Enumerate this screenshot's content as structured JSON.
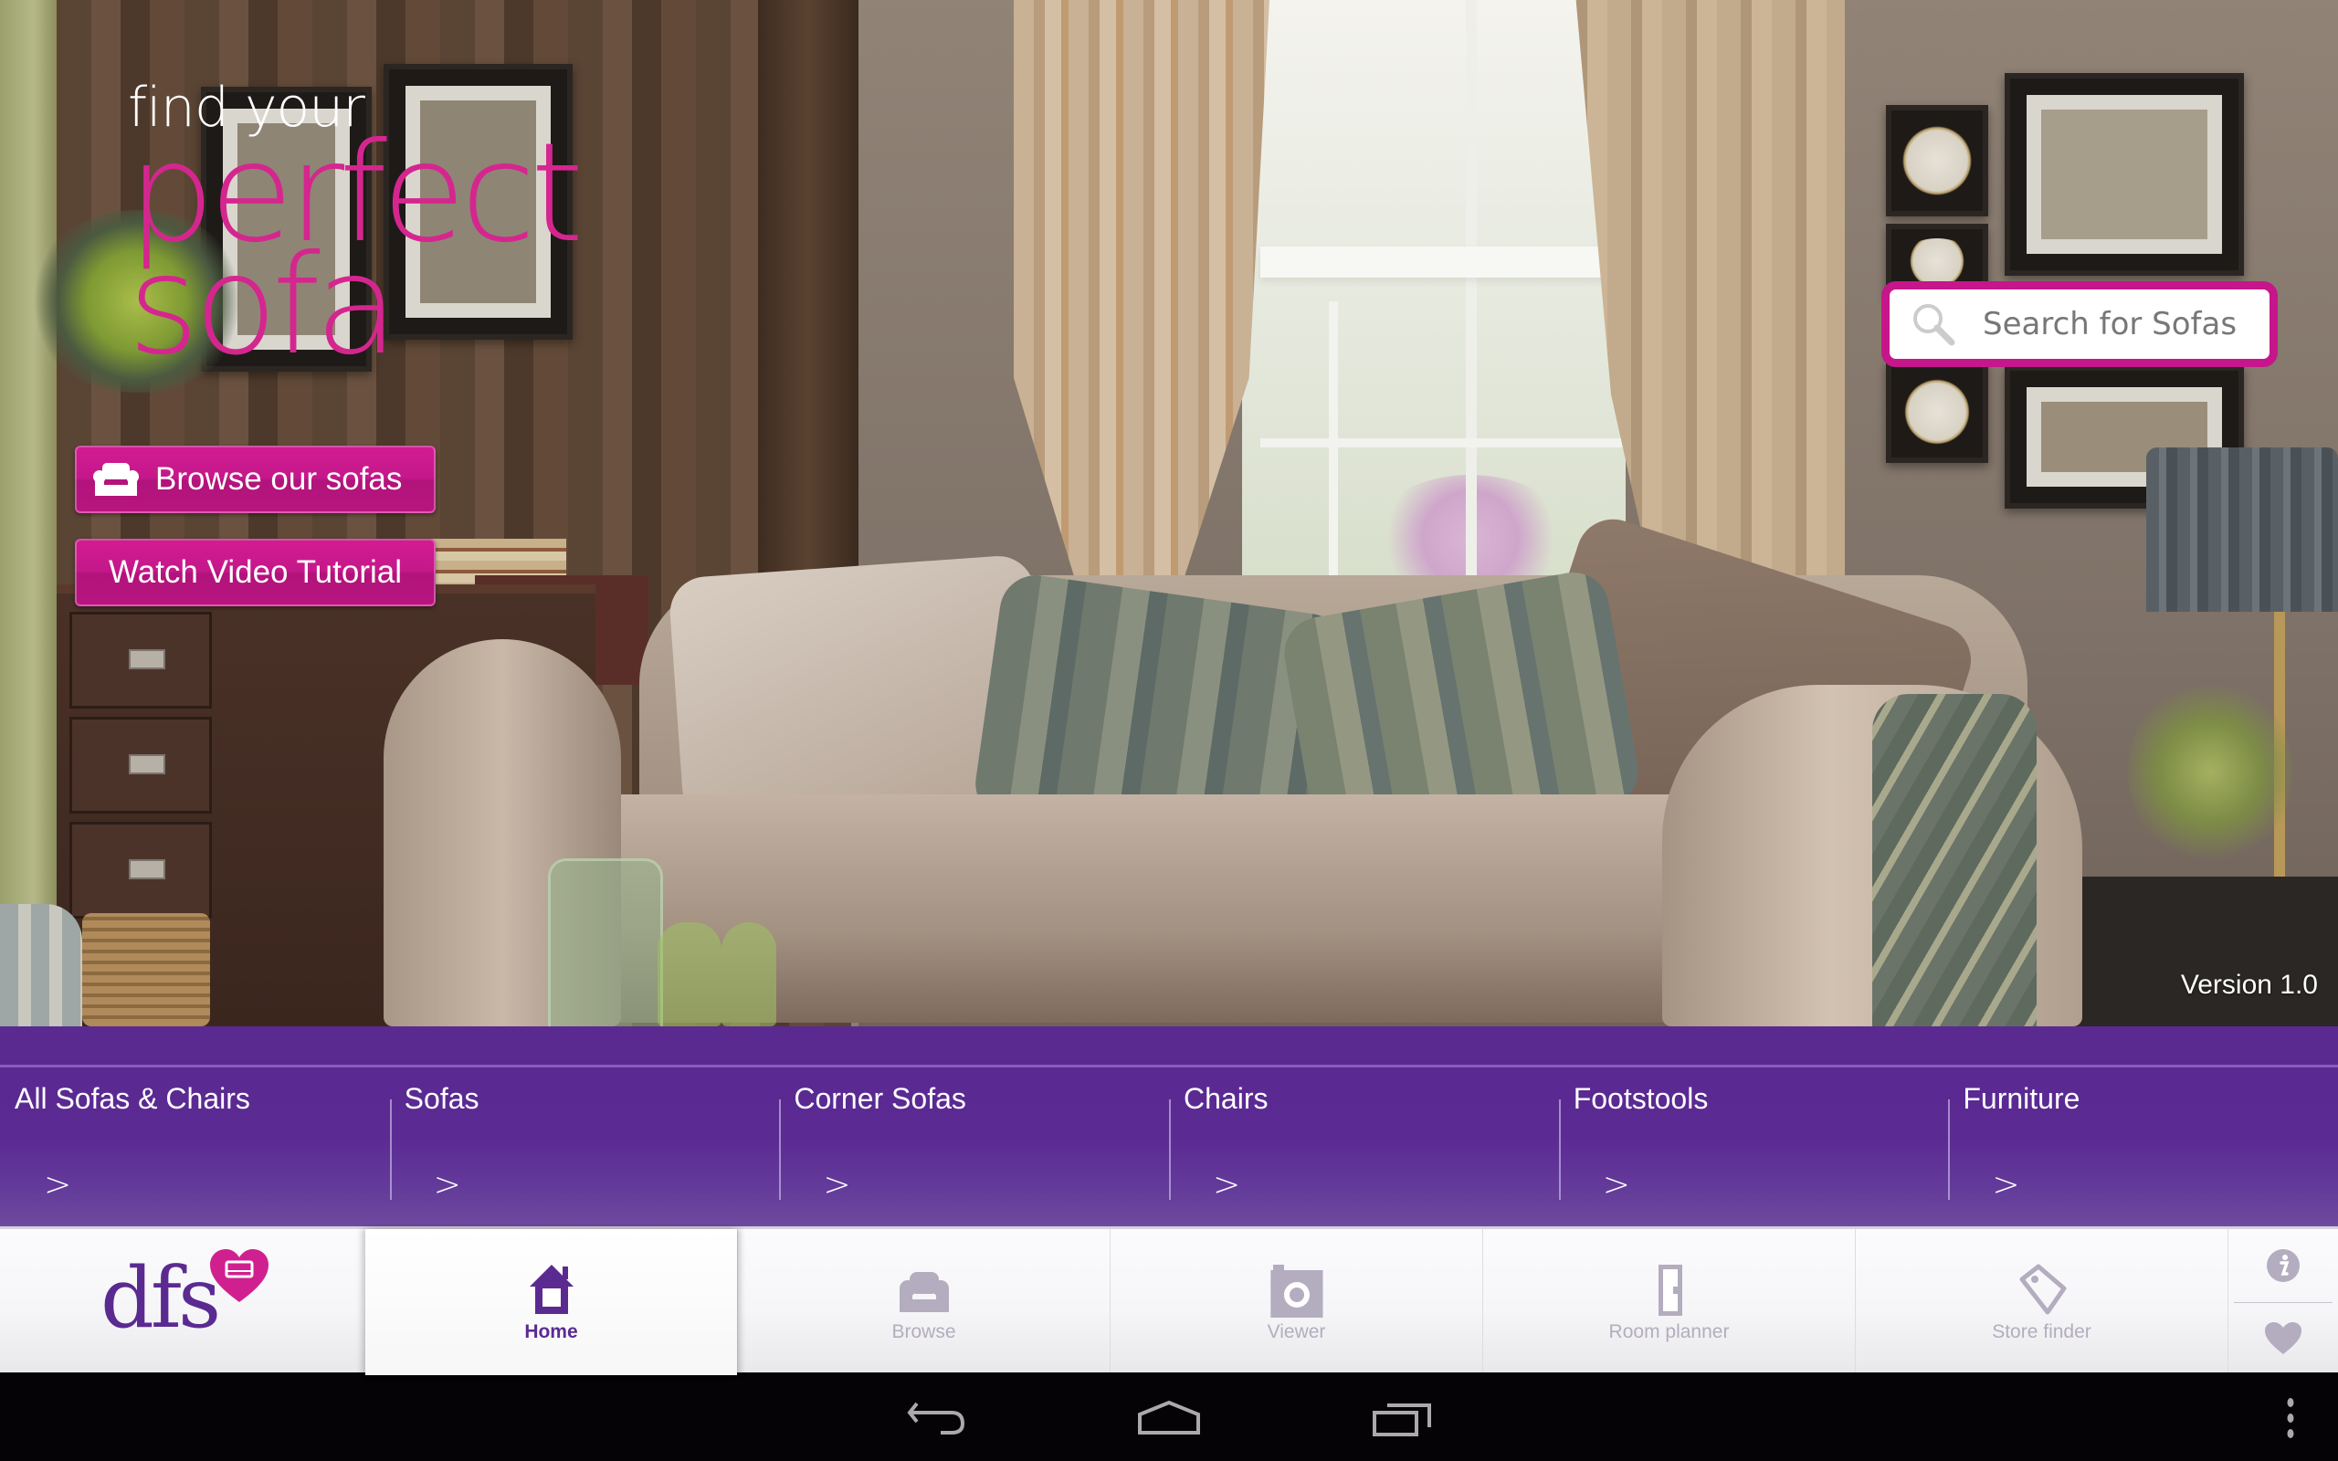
{
  "hero": {
    "tagline": {
      "line1": "find your",
      "line2": "perfect",
      "line3": "sofa"
    },
    "buttons": {
      "browse": {
        "label": "Browse our sofas",
        "icon": "armchair-icon"
      },
      "video": {
        "label": "Watch Video Tutorial"
      }
    },
    "search": {
      "placeholder": "Search for Sofas",
      "icon": "search-icon"
    },
    "version": "Version 1.0"
  },
  "categories": [
    {
      "label": "All Sofas & Chairs",
      "chevron": ">"
    },
    {
      "label": "Sofas",
      "chevron": ">"
    },
    {
      "label": "Corner Sofas",
      "chevron": ">"
    },
    {
      "label": "Chairs",
      "chevron": ">"
    },
    {
      "label": "Footstools",
      "chevron": ">"
    },
    {
      "label": "Furniture",
      "chevron": ">"
    }
  ],
  "appnav": {
    "logo_text": "dfs",
    "tabs": [
      {
        "label": "Home",
        "icon": "home-icon",
        "active": true
      },
      {
        "label": "Browse",
        "icon": "armchair-icon",
        "active": false
      },
      {
        "label": "Viewer",
        "icon": "camera-icon",
        "active": false
      },
      {
        "label": "Room planner",
        "icon": "door-icon",
        "active": false
      },
      {
        "label": "Store finder",
        "icon": "tag-icon",
        "active": false
      }
    ],
    "side": [
      {
        "icon": "info-icon"
      },
      {
        "icon": "heart-icon"
      }
    ]
  },
  "system_bar": {
    "buttons": [
      "back",
      "home",
      "recent-apps",
      "menu"
    ]
  },
  "colors": {
    "brand_pink": "#d5268f",
    "brand_purple": "#5b2a91",
    "inactive_icon": "#b3adbf"
  }
}
